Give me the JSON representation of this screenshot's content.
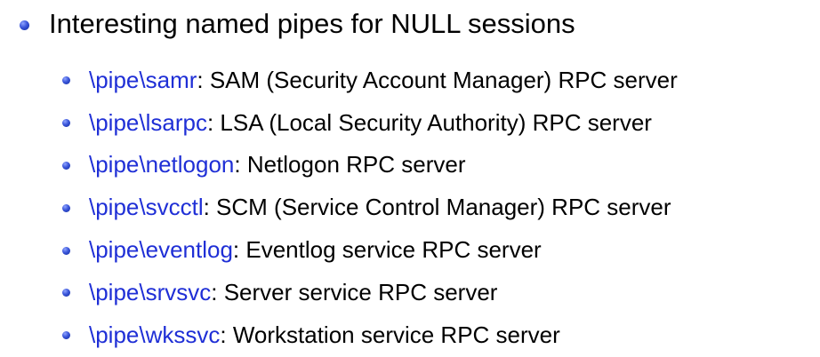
{
  "heading": "Interesting named pipes for NULL sessions",
  "colors": {
    "pipe_link": "#1f2fd6",
    "text": "#000000",
    "bullet": "#3a55d9"
  },
  "items": [
    {
      "pipe": "\\pipe\\samr",
      "desc": ": SAM (Security Account Manager) RPC server"
    },
    {
      "pipe": "\\pipe\\lsarpc",
      "desc": ": LSA (Local Security Authority) RPC server"
    },
    {
      "pipe": "\\pipe\\netlogon",
      "desc": ": Netlogon RPC server"
    },
    {
      "pipe": "\\pipe\\svcctl",
      "desc": ": SCM (Service Control Manager) RPC server"
    },
    {
      "pipe": "\\pipe\\eventlog",
      "desc": ": Eventlog service RPC server"
    },
    {
      "pipe": "\\pipe\\srvsvc",
      "desc": ": Server service RPC server"
    },
    {
      "pipe": "\\pipe\\wkssvc",
      "desc": ": Workstation service RPC server"
    }
  ]
}
